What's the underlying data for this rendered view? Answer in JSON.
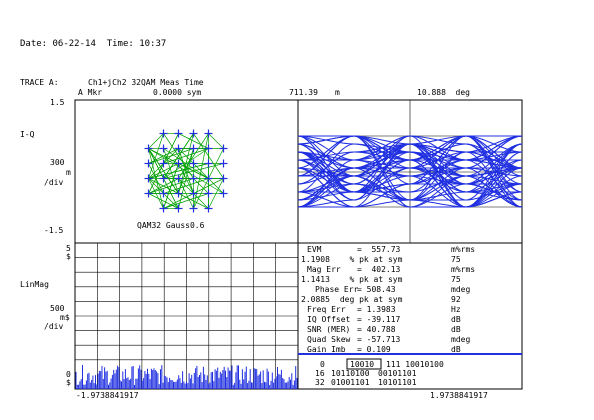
{
  "header": {
    "date_time": "Date: 06-22-14  Time: 10:37",
    "trace_label": "TRACE A:",
    "trace_desc": "Ch1+jCh2 32QAM Meas Time",
    "marker_label": "A Mkr",
    "marker_sym": "0.0000 sym",
    "marker_mag": "711.39",
    "marker_mag_unit": "m",
    "marker_phase": "10.888  deg"
  },
  "iq_axis": {
    "top": "1.5",
    "name": "I-Q",
    "scale": "300",
    "scale_unit": "m",
    "per_div": "/div",
    "bottom": "-1.5",
    "mod_label": "QAM32 Gauss0.6"
  },
  "linmag_axis": {
    "top_val": "5",
    "top_unit": "$",
    "name": "LinMag",
    "scale": "500",
    "scale_unit": "m$",
    "per_div": "/div",
    "bottom_val": "0",
    "bottom_unit": "$",
    "x_left": "-1.9738841917",
    "x_right": "1.9738841917"
  },
  "metrics": [
    {
      "label": "EVM",
      "value": "=  557.73",
      "unit": "m%rms"
    },
    {
      "label": "1.1908",
      "value": "   % pk at sym",
      "unit": "75"
    },
    {
      "label": "Mag Err",
      "value": "=  402.13",
      "unit": "m%rms"
    },
    {
      "label": "1.1413",
      "value": "   % pk at sym",
      "unit": "75"
    },
    {
      "label": "Phase Err",
      "value": "= 508.43",
      "unit": "mdeg"
    },
    {
      "label": "2.0885",
      "value": " deg pk at sym",
      "unit": "92"
    },
    {
      "label": "Freq Err",
      "value": "= 1.3983",
      "unit": "Hz"
    },
    {
      "label": "IQ Offset",
      "value": "= -39.117",
      "unit": "dB"
    },
    {
      "label": "SNR (MER)",
      "value": "= 40.788",
      "unit": "dB"
    },
    {
      "label": "Quad Skew",
      "value": "= -57.713",
      "unit": "mdeg"
    },
    {
      "label": "Gain Imb",
      "value": "= 0.109",
      "unit": "dB"
    }
  ],
  "bits": [
    {
      "index": "0",
      "a": "10010",
      "b": "111 10010100"
    },
    {
      "index": "16",
      "a": "10110100",
      "b": "00101101"
    },
    {
      "index": "32",
      "a": "01001101",
      "b": "10101101"
    }
  ],
  "colors": {
    "trace": "#2030e0",
    "points": "#00a000",
    "grid": "#000000"
  }
}
